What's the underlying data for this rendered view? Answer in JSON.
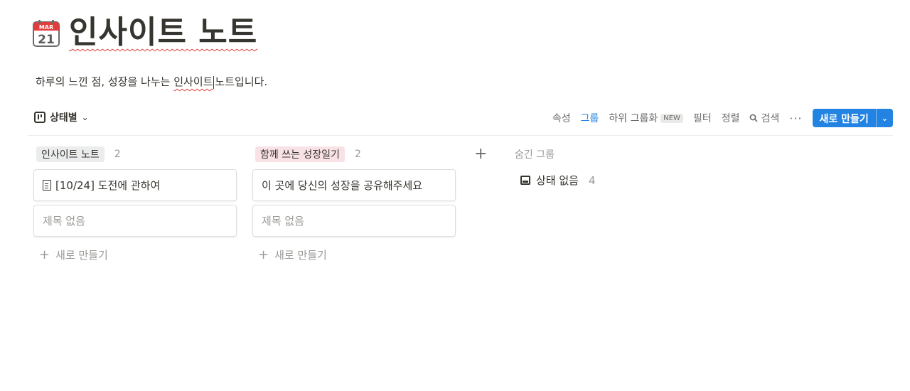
{
  "page": {
    "icon_month": "MAR",
    "icon_day": "21",
    "title": "인사이트 노트",
    "description_before": "하루의 느낀 점, 성장을 나누는 ",
    "description_highlight": "인사이트",
    "description_after": "노트입니다."
  },
  "view": {
    "label": "상태별",
    "chevron": "⌄"
  },
  "toolbar": {
    "properties": "속성",
    "group": "그룹",
    "subgroup": "하위 그룹화",
    "new_badge": "NEW",
    "filter": "필터",
    "sort": "정렬",
    "search": "검색",
    "more": "···",
    "new_button": "새로 만들기",
    "new_arrow": "⌄"
  },
  "columns": [
    {
      "name": "인사이트 노트",
      "count": "2",
      "cards": [
        {
          "title": "[10/24] 도전에 관하여"
        },
        {
          "title": "제목 없음"
        }
      ],
      "add_label": "새로 만들기"
    },
    {
      "name": "함께 쓰는 성장일기",
      "count": "2",
      "cards": [
        {
          "title": "이 곳에 당신의 성장을 공유해주세요"
        },
        {
          "title": "제목 없음"
        }
      ],
      "add_label": "새로 만들기"
    }
  ],
  "add_group": "+",
  "hidden_groups": {
    "title": "숨긴 그룹",
    "items": [
      {
        "label": "상태 없음",
        "count": "4"
      }
    ]
  },
  "colors": {
    "accent": "#2383e2",
    "tag_gray": "#ebeced",
    "tag_pink": "#f9e2e6",
    "calendar_red": "#e03e3e"
  }
}
